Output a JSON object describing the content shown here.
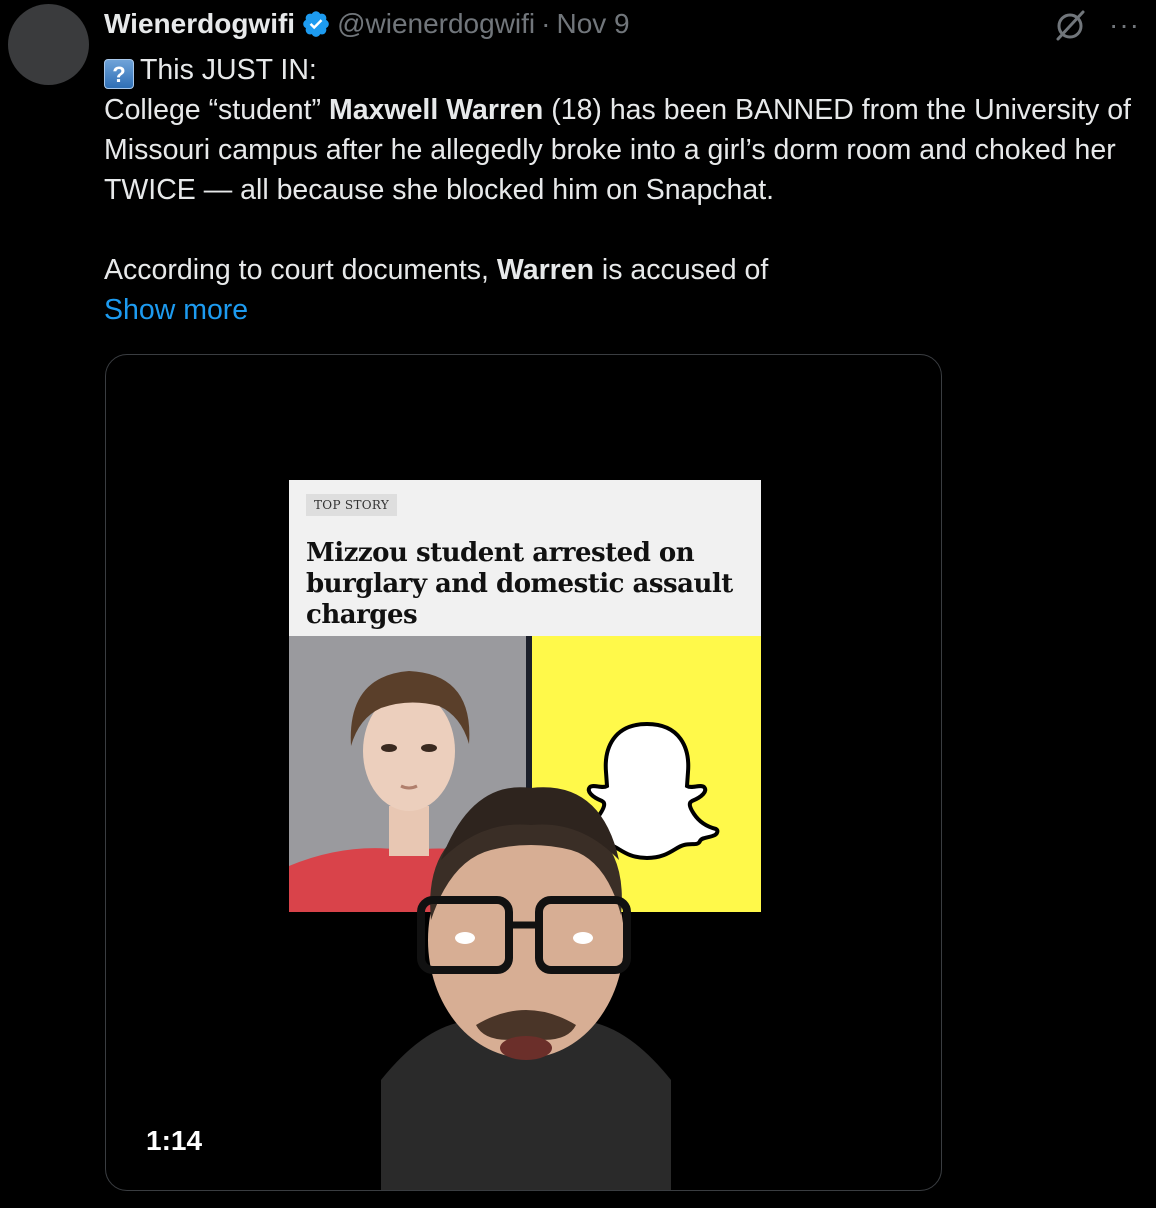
{
  "post": {
    "author_name": "Wienerdogwifi",
    "handle": "@wienerdogwifi",
    "separator": "·",
    "date": "Nov 9",
    "more_label": "···",
    "line1_emoji": "?",
    "line1_text": "This JUST IN:",
    "p1_a": "College “student” ",
    "p1_name": "Maxwell Warren",
    "p1_b": " (18) has been BANNED from the University of Missouri campus after he allegedly broke into a girl’s dorm room and choked her TWICE — all because she blocked him on Snapchat.",
    "p2_a": "According to court documents, ",
    "p2_name": "Warren",
    "p2_b": " is accused of",
    "show_more": "Show more"
  },
  "media": {
    "article_tag": "TOP STORY",
    "article_headline": "Mizzou student arrested on burglary and domestic assault charges",
    "duration": "1:14"
  },
  "colors": {
    "background": "#000000",
    "text": "#e7e9ea",
    "muted": "#71767b",
    "link": "#1d9bf0",
    "verified": "#1d9bf0",
    "snapchat_yellow": "#fff94a"
  },
  "icons": {
    "verified": "verified-badge-icon",
    "grok": "grok-icon",
    "more": "more-icon",
    "snapchat": "snapchat-ghost-icon"
  }
}
